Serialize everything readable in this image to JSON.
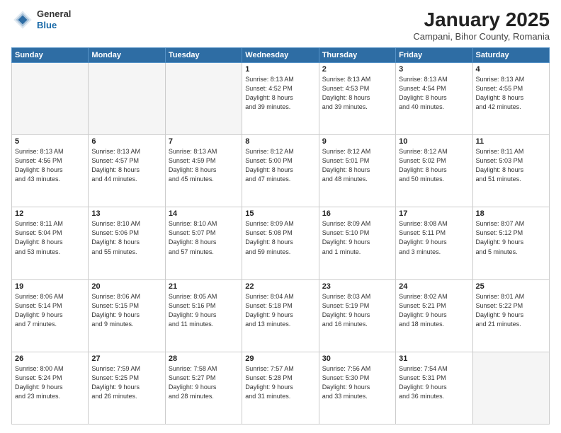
{
  "header": {
    "logo_general": "General",
    "logo_blue": "Blue",
    "month_title": "January 2025",
    "location": "Campani, Bihor County, Romania"
  },
  "weekdays": [
    "Sunday",
    "Monday",
    "Tuesday",
    "Wednesday",
    "Thursday",
    "Friday",
    "Saturday"
  ],
  "weeks": [
    [
      {
        "day": "",
        "info": ""
      },
      {
        "day": "",
        "info": ""
      },
      {
        "day": "",
        "info": ""
      },
      {
        "day": "1",
        "info": "Sunrise: 8:13 AM\nSunset: 4:52 PM\nDaylight: 8 hours\nand 39 minutes."
      },
      {
        "day": "2",
        "info": "Sunrise: 8:13 AM\nSunset: 4:53 PM\nDaylight: 8 hours\nand 39 minutes."
      },
      {
        "day": "3",
        "info": "Sunrise: 8:13 AM\nSunset: 4:54 PM\nDaylight: 8 hours\nand 40 minutes."
      },
      {
        "day": "4",
        "info": "Sunrise: 8:13 AM\nSunset: 4:55 PM\nDaylight: 8 hours\nand 42 minutes."
      }
    ],
    [
      {
        "day": "5",
        "info": "Sunrise: 8:13 AM\nSunset: 4:56 PM\nDaylight: 8 hours\nand 43 minutes."
      },
      {
        "day": "6",
        "info": "Sunrise: 8:13 AM\nSunset: 4:57 PM\nDaylight: 8 hours\nand 44 minutes."
      },
      {
        "day": "7",
        "info": "Sunrise: 8:13 AM\nSunset: 4:59 PM\nDaylight: 8 hours\nand 45 minutes."
      },
      {
        "day": "8",
        "info": "Sunrise: 8:12 AM\nSunset: 5:00 PM\nDaylight: 8 hours\nand 47 minutes."
      },
      {
        "day": "9",
        "info": "Sunrise: 8:12 AM\nSunset: 5:01 PM\nDaylight: 8 hours\nand 48 minutes."
      },
      {
        "day": "10",
        "info": "Sunrise: 8:12 AM\nSunset: 5:02 PM\nDaylight: 8 hours\nand 50 minutes."
      },
      {
        "day": "11",
        "info": "Sunrise: 8:11 AM\nSunset: 5:03 PM\nDaylight: 8 hours\nand 51 minutes."
      }
    ],
    [
      {
        "day": "12",
        "info": "Sunrise: 8:11 AM\nSunset: 5:04 PM\nDaylight: 8 hours\nand 53 minutes."
      },
      {
        "day": "13",
        "info": "Sunrise: 8:10 AM\nSunset: 5:06 PM\nDaylight: 8 hours\nand 55 minutes."
      },
      {
        "day": "14",
        "info": "Sunrise: 8:10 AM\nSunset: 5:07 PM\nDaylight: 8 hours\nand 57 minutes."
      },
      {
        "day": "15",
        "info": "Sunrise: 8:09 AM\nSunset: 5:08 PM\nDaylight: 8 hours\nand 59 minutes."
      },
      {
        "day": "16",
        "info": "Sunrise: 8:09 AM\nSunset: 5:10 PM\nDaylight: 9 hours\nand 1 minute."
      },
      {
        "day": "17",
        "info": "Sunrise: 8:08 AM\nSunset: 5:11 PM\nDaylight: 9 hours\nand 3 minutes."
      },
      {
        "day": "18",
        "info": "Sunrise: 8:07 AM\nSunset: 5:12 PM\nDaylight: 9 hours\nand 5 minutes."
      }
    ],
    [
      {
        "day": "19",
        "info": "Sunrise: 8:06 AM\nSunset: 5:14 PM\nDaylight: 9 hours\nand 7 minutes."
      },
      {
        "day": "20",
        "info": "Sunrise: 8:06 AM\nSunset: 5:15 PM\nDaylight: 9 hours\nand 9 minutes."
      },
      {
        "day": "21",
        "info": "Sunrise: 8:05 AM\nSunset: 5:16 PM\nDaylight: 9 hours\nand 11 minutes."
      },
      {
        "day": "22",
        "info": "Sunrise: 8:04 AM\nSunset: 5:18 PM\nDaylight: 9 hours\nand 13 minutes."
      },
      {
        "day": "23",
        "info": "Sunrise: 8:03 AM\nSunset: 5:19 PM\nDaylight: 9 hours\nand 16 minutes."
      },
      {
        "day": "24",
        "info": "Sunrise: 8:02 AM\nSunset: 5:21 PM\nDaylight: 9 hours\nand 18 minutes."
      },
      {
        "day": "25",
        "info": "Sunrise: 8:01 AM\nSunset: 5:22 PM\nDaylight: 9 hours\nand 21 minutes."
      }
    ],
    [
      {
        "day": "26",
        "info": "Sunrise: 8:00 AM\nSunset: 5:24 PM\nDaylight: 9 hours\nand 23 minutes."
      },
      {
        "day": "27",
        "info": "Sunrise: 7:59 AM\nSunset: 5:25 PM\nDaylight: 9 hours\nand 26 minutes."
      },
      {
        "day": "28",
        "info": "Sunrise: 7:58 AM\nSunset: 5:27 PM\nDaylight: 9 hours\nand 28 minutes."
      },
      {
        "day": "29",
        "info": "Sunrise: 7:57 AM\nSunset: 5:28 PM\nDaylight: 9 hours\nand 31 minutes."
      },
      {
        "day": "30",
        "info": "Sunrise: 7:56 AM\nSunset: 5:30 PM\nDaylight: 9 hours\nand 33 minutes."
      },
      {
        "day": "31",
        "info": "Sunrise: 7:54 AM\nSunset: 5:31 PM\nDaylight: 9 hours\nand 36 minutes."
      },
      {
        "day": "",
        "info": ""
      }
    ]
  ]
}
